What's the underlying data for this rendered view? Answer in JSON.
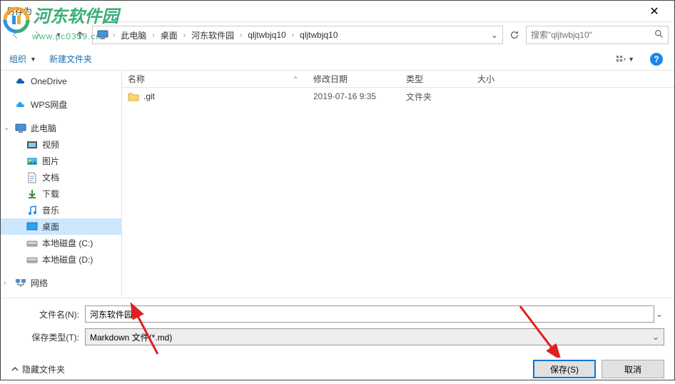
{
  "window": {
    "title": "另存为"
  },
  "nav": {
    "crumbs": [
      "此电脑",
      "桌面",
      "河东软件园",
      "qljtwbjq10",
      "qljtwbjq10"
    ],
    "search_placeholder": "搜索\"qljtwbjq10\""
  },
  "toolbar": {
    "organize": "组织",
    "new_folder": "新建文件夹"
  },
  "sidebar": {
    "items": [
      {
        "label": "OneDrive",
        "icon": "onedrive",
        "indent": 0
      },
      {
        "label": "WPS网盘",
        "icon": "wps",
        "indent": 0
      },
      {
        "label": "此电脑",
        "icon": "pc",
        "indent": 0,
        "expandable": true
      },
      {
        "label": "视频",
        "icon": "video",
        "indent": 1
      },
      {
        "label": "图片",
        "icon": "picture",
        "indent": 1
      },
      {
        "label": "文档",
        "icon": "document",
        "indent": 1
      },
      {
        "label": "下载",
        "icon": "download",
        "indent": 1
      },
      {
        "label": "音乐",
        "icon": "music",
        "indent": 1
      },
      {
        "label": "桌面",
        "icon": "desktop",
        "indent": 1,
        "selected": true
      },
      {
        "label": "本地磁盘 (C:)",
        "icon": "drive",
        "indent": 1
      },
      {
        "label": "本地磁盘 (D:)",
        "icon": "drive",
        "indent": 1
      },
      {
        "label": "网络",
        "icon": "network",
        "indent": 0,
        "expandable": true
      }
    ]
  },
  "filelist": {
    "columns": {
      "name": "名称",
      "date": "修改日期",
      "type": "类型",
      "size": "大小"
    },
    "rows": [
      {
        "name": ".git",
        "date": "2019-07-16 9:35",
        "type": "文件夹",
        "size": ""
      }
    ]
  },
  "form": {
    "filename_label": "文件名(N):",
    "filename_value": "河东软件园",
    "filetype_label": "保存类型(T):",
    "filetype_value": "Markdown 文件(*.md)"
  },
  "buttons": {
    "hide_folders": "隐藏文件夹",
    "save": "保存(S)",
    "cancel": "取消"
  },
  "watermark": {
    "text": "河东软件园",
    "url": "www.pc0359.cn"
  }
}
